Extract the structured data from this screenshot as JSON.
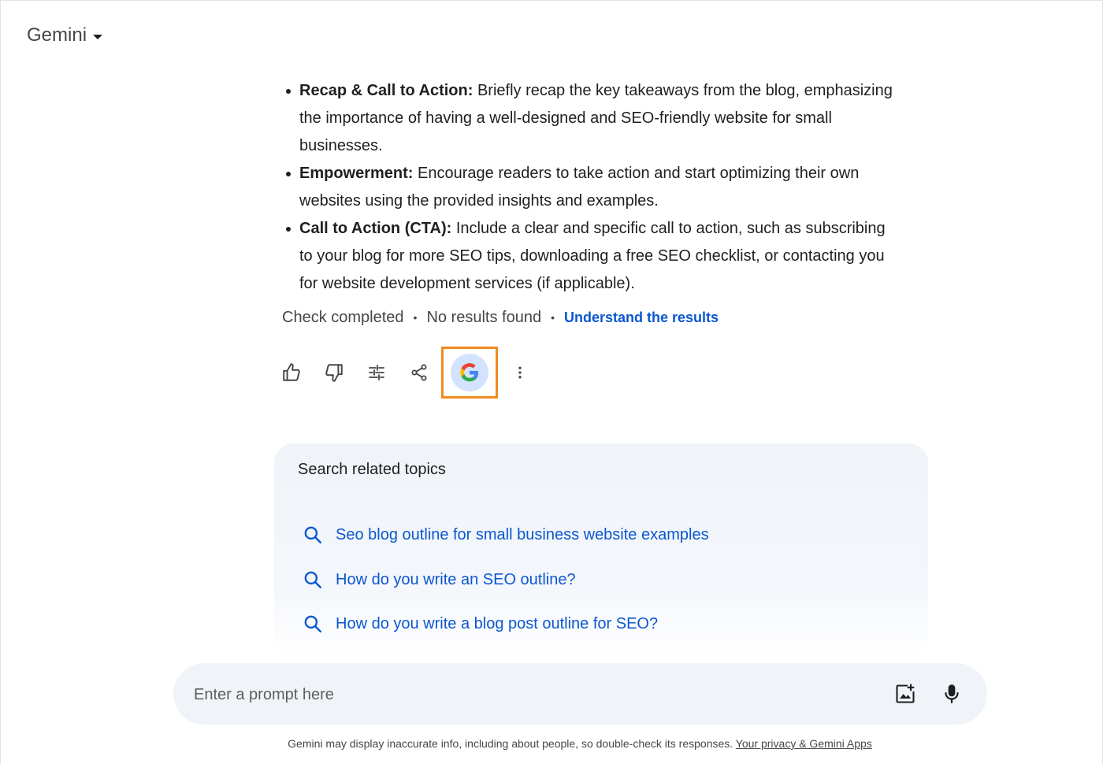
{
  "header": {
    "app_title": "Gemini"
  },
  "response": {
    "bullets": [
      {
        "bold": "Recap & Call to Action:",
        "text": " Briefly recap the key takeaways from the blog, emphasizing the importance of having a well-designed and SEO-friendly website for small businesses."
      },
      {
        "bold": "Empowerment:",
        "text": " Encourage readers to take action and start optimizing their own websites using the provided insights and examples."
      },
      {
        "bold": "Call to Action (CTA):",
        "text": " Include a clear and specific call to action, such as subscribing to your blog for more SEO tips, downloading a free SEO checklist, or contacting you for website development services (if applicable)."
      }
    ],
    "check_status": "Check completed",
    "check_result": "No results found",
    "check_link": "Understand the results"
  },
  "actions": {
    "icons": [
      "thumbs-up-icon",
      "thumbs-down-icon",
      "tune-icon",
      "share-icon",
      "google-g-icon",
      "more-vert-icon"
    ],
    "highlight_color": "#f28a1e"
  },
  "related": {
    "title": "Search related topics",
    "topics": [
      "Seo blog outline for small business website examples",
      "How do you write an SEO outline?",
      "How do you write a blog post outline for SEO?"
    ]
  },
  "prompt": {
    "placeholder": "Enter a prompt here",
    "value": ""
  },
  "footer": {
    "disclaimer": "Gemini may display inaccurate info, including about people, so double-check its responses.",
    "privacy_link": "Your privacy & Gemini Apps"
  },
  "colors": {
    "link_blue": "#0b57d0",
    "surface": "#f0f4f9",
    "g_button_bg": "#d3e3fd"
  }
}
